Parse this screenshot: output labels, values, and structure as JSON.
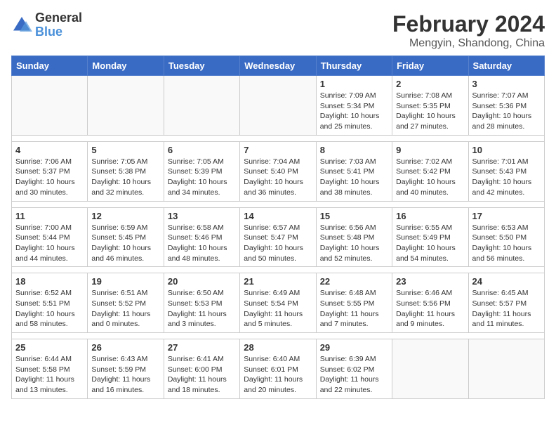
{
  "logo": {
    "text_general": "General",
    "text_blue": "Blue"
  },
  "title": "February 2024",
  "subtitle": "Mengyin, Shandong, China",
  "weekdays": [
    "Sunday",
    "Monday",
    "Tuesday",
    "Wednesday",
    "Thursday",
    "Friday",
    "Saturday"
  ],
  "weeks": [
    [
      {
        "day": "",
        "info": ""
      },
      {
        "day": "",
        "info": ""
      },
      {
        "day": "",
        "info": ""
      },
      {
        "day": "",
        "info": ""
      },
      {
        "day": "1",
        "info": "Sunrise: 7:09 AM\nSunset: 5:34 PM\nDaylight: 10 hours\nand 25 minutes."
      },
      {
        "day": "2",
        "info": "Sunrise: 7:08 AM\nSunset: 5:35 PM\nDaylight: 10 hours\nand 27 minutes."
      },
      {
        "day": "3",
        "info": "Sunrise: 7:07 AM\nSunset: 5:36 PM\nDaylight: 10 hours\nand 28 minutes."
      }
    ],
    [
      {
        "day": "4",
        "info": "Sunrise: 7:06 AM\nSunset: 5:37 PM\nDaylight: 10 hours\nand 30 minutes."
      },
      {
        "day": "5",
        "info": "Sunrise: 7:05 AM\nSunset: 5:38 PM\nDaylight: 10 hours\nand 32 minutes."
      },
      {
        "day": "6",
        "info": "Sunrise: 7:05 AM\nSunset: 5:39 PM\nDaylight: 10 hours\nand 34 minutes."
      },
      {
        "day": "7",
        "info": "Sunrise: 7:04 AM\nSunset: 5:40 PM\nDaylight: 10 hours\nand 36 minutes."
      },
      {
        "day": "8",
        "info": "Sunrise: 7:03 AM\nSunset: 5:41 PM\nDaylight: 10 hours\nand 38 minutes."
      },
      {
        "day": "9",
        "info": "Sunrise: 7:02 AM\nSunset: 5:42 PM\nDaylight: 10 hours\nand 40 minutes."
      },
      {
        "day": "10",
        "info": "Sunrise: 7:01 AM\nSunset: 5:43 PM\nDaylight: 10 hours\nand 42 minutes."
      }
    ],
    [
      {
        "day": "11",
        "info": "Sunrise: 7:00 AM\nSunset: 5:44 PM\nDaylight: 10 hours\nand 44 minutes."
      },
      {
        "day": "12",
        "info": "Sunrise: 6:59 AM\nSunset: 5:45 PM\nDaylight: 10 hours\nand 46 minutes."
      },
      {
        "day": "13",
        "info": "Sunrise: 6:58 AM\nSunset: 5:46 PM\nDaylight: 10 hours\nand 48 minutes."
      },
      {
        "day": "14",
        "info": "Sunrise: 6:57 AM\nSunset: 5:47 PM\nDaylight: 10 hours\nand 50 minutes."
      },
      {
        "day": "15",
        "info": "Sunrise: 6:56 AM\nSunset: 5:48 PM\nDaylight: 10 hours\nand 52 minutes."
      },
      {
        "day": "16",
        "info": "Sunrise: 6:55 AM\nSunset: 5:49 PM\nDaylight: 10 hours\nand 54 minutes."
      },
      {
        "day": "17",
        "info": "Sunrise: 6:53 AM\nSunset: 5:50 PM\nDaylight: 10 hours\nand 56 minutes."
      }
    ],
    [
      {
        "day": "18",
        "info": "Sunrise: 6:52 AM\nSunset: 5:51 PM\nDaylight: 10 hours\nand 58 minutes."
      },
      {
        "day": "19",
        "info": "Sunrise: 6:51 AM\nSunset: 5:52 PM\nDaylight: 11 hours\nand 0 minutes."
      },
      {
        "day": "20",
        "info": "Sunrise: 6:50 AM\nSunset: 5:53 PM\nDaylight: 11 hours\nand 3 minutes."
      },
      {
        "day": "21",
        "info": "Sunrise: 6:49 AM\nSunset: 5:54 PM\nDaylight: 11 hours\nand 5 minutes."
      },
      {
        "day": "22",
        "info": "Sunrise: 6:48 AM\nSunset: 5:55 PM\nDaylight: 11 hours\nand 7 minutes."
      },
      {
        "day": "23",
        "info": "Sunrise: 6:46 AM\nSunset: 5:56 PM\nDaylight: 11 hours\nand 9 minutes."
      },
      {
        "day": "24",
        "info": "Sunrise: 6:45 AM\nSunset: 5:57 PM\nDaylight: 11 hours\nand 11 minutes."
      }
    ],
    [
      {
        "day": "25",
        "info": "Sunrise: 6:44 AM\nSunset: 5:58 PM\nDaylight: 11 hours\nand 13 minutes."
      },
      {
        "day": "26",
        "info": "Sunrise: 6:43 AM\nSunset: 5:59 PM\nDaylight: 11 hours\nand 16 minutes."
      },
      {
        "day": "27",
        "info": "Sunrise: 6:41 AM\nSunset: 6:00 PM\nDaylight: 11 hours\nand 18 minutes."
      },
      {
        "day": "28",
        "info": "Sunrise: 6:40 AM\nSunset: 6:01 PM\nDaylight: 11 hours\nand 20 minutes."
      },
      {
        "day": "29",
        "info": "Sunrise: 6:39 AM\nSunset: 6:02 PM\nDaylight: 11 hours\nand 22 minutes."
      },
      {
        "day": "",
        "info": ""
      },
      {
        "day": "",
        "info": ""
      }
    ]
  ]
}
